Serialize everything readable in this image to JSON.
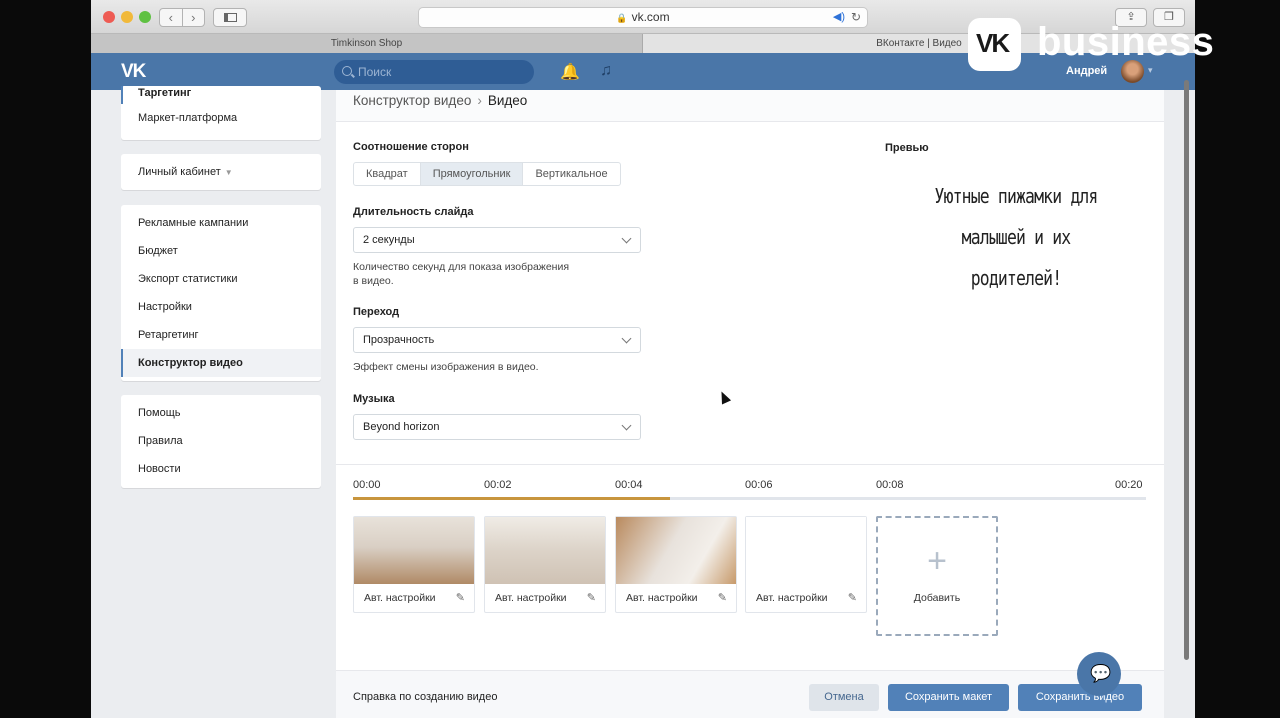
{
  "browser": {
    "url": "vk.com",
    "tabs": [
      {
        "label": "Timkinson Shop"
      },
      {
        "label": "ВКонтакте | Видео"
      }
    ]
  },
  "header": {
    "logo": "VK",
    "search_placeholder": "Поиск",
    "user_name": "Андрей"
  },
  "sidebar": {
    "group1": [
      {
        "label": "Таргетинг"
      },
      {
        "label": "Маркет-платформа"
      }
    ],
    "cabinet": {
      "label": "Личный кабинет"
    },
    "group2": [
      {
        "label": "Рекламные кампании"
      },
      {
        "label": "Бюджет"
      },
      {
        "label": "Экспорт статистики"
      },
      {
        "label": "Настройки"
      },
      {
        "label": "Ретаргетинг"
      },
      {
        "label": "Конструктор видео",
        "active": true
      }
    ],
    "group3": [
      {
        "label": "Помощь"
      },
      {
        "label": "Правила"
      },
      {
        "label": "Новости"
      }
    ]
  },
  "main": {
    "breadcrumb": {
      "parent": "Конструктор видео",
      "separator": "›",
      "current": "Видео"
    },
    "aspect": {
      "label": "Соотношение сторон",
      "options": [
        "Квадрат",
        "Прямоугольник",
        "Вертикальное"
      ],
      "selected": "Прямоугольник"
    },
    "duration": {
      "label": "Длительность слайда",
      "value": "2 секунды",
      "hint_line1": "Количество секунд для показа изображения",
      "hint_line2": "в видео."
    },
    "transition": {
      "label": "Переход",
      "value": "Прозрачность",
      "hint": "Эффект смены изображения в видео."
    },
    "music": {
      "label": "Музыка",
      "value": "Beyond horizon"
    },
    "preview": {
      "label": "Превью",
      "line1": "Уютные пижамки для",
      "line2": "малышей и их",
      "line3": "родителей!"
    },
    "timeline": {
      "ticks": [
        "00:00",
        "00:02",
        "00:04",
        "00:06",
        "00:08",
        "00:20"
      ],
      "progress_fraction": 0.4
    },
    "slides": [
      {
        "label": "Авт. настройки"
      },
      {
        "label": "Авт. настройки"
      },
      {
        "label": "Авт. настройки"
      },
      {
        "label": "Авт. настройки"
      }
    ],
    "add_slide": {
      "plus": "+",
      "label": "Добавить"
    }
  },
  "footer": {
    "help_link": "Справка по созданию видео",
    "cancel": "Отмена",
    "save_layout": "Сохранить макет",
    "save_video": "Сохранить видео"
  },
  "watermark": {
    "logo": "VK",
    "text": "business"
  },
  "colors": {
    "vk_blue": "#4a76a8",
    "button_blue": "#5181b8",
    "progress": "#c8953d"
  }
}
